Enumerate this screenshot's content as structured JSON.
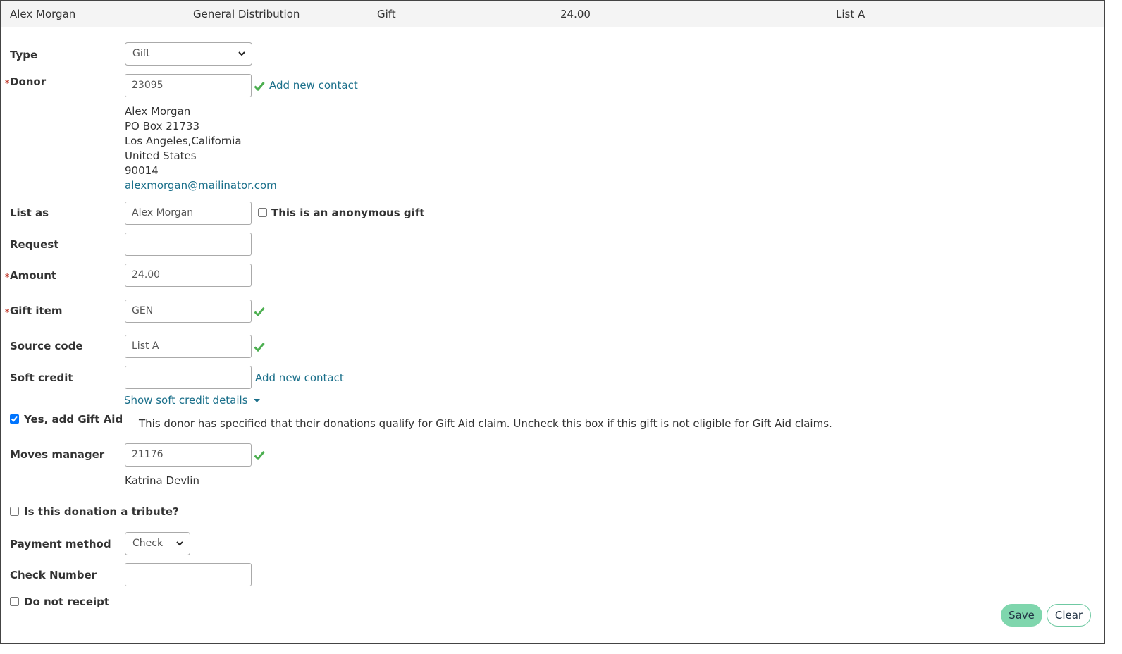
{
  "summary": {
    "name": "Alex Morgan",
    "fund": "General Distribution",
    "type": "Gift",
    "amount": "24.00",
    "list": "List A"
  },
  "form": {
    "type": {
      "label": "Type",
      "value": "Gift"
    },
    "donor": {
      "label": "Donor",
      "value": "23095",
      "add_contact": "Add new contact",
      "address": {
        "name": "Alex Morgan",
        "line1": "PO Box 21733",
        "city_state": "Los Angeles,California",
        "country": "United States",
        "zip": "90014",
        "email": "alexmorgan@mailinator.com"
      }
    },
    "list_as": {
      "label": "List as",
      "value": "Alex Morgan",
      "anonymous_label": "This is an anonymous gift",
      "anonymous_checked": false
    },
    "request": {
      "label": "Request",
      "value": ""
    },
    "amount": {
      "label": "Amount",
      "value": "24.00"
    },
    "gift_item": {
      "label": "Gift item",
      "value": "GEN"
    },
    "source_code": {
      "label": "Source code",
      "value": "List A"
    },
    "soft_credit": {
      "label": "Soft credit",
      "value": "",
      "add_contact": "Add new contact",
      "show_details": "Show soft credit details"
    },
    "gift_aid": {
      "label": "Yes, add Gift Aid",
      "checked": true,
      "note": "This donor has specified that their donations qualify for Gift Aid claim. Uncheck this box if this gift is not eligible for Gift Aid claims."
    },
    "moves_manager": {
      "label": "Moves manager",
      "value": "21176",
      "name": "Katrina Devlin"
    },
    "tribute": {
      "label": "Is this donation a tribute?",
      "checked": false
    },
    "payment_method": {
      "label": "Payment method",
      "value": "Check"
    },
    "check_number": {
      "label": "Check Number",
      "value": ""
    },
    "do_not_receipt": {
      "label": "Do not receipt",
      "checked": false
    }
  },
  "buttons": {
    "save": "Save",
    "clear": "Clear"
  },
  "colors": {
    "accent_link": "#1a6f8a",
    "check_green": "#4caf50",
    "save_bg": "#7fd6ad",
    "required_star": "#c0392b"
  }
}
